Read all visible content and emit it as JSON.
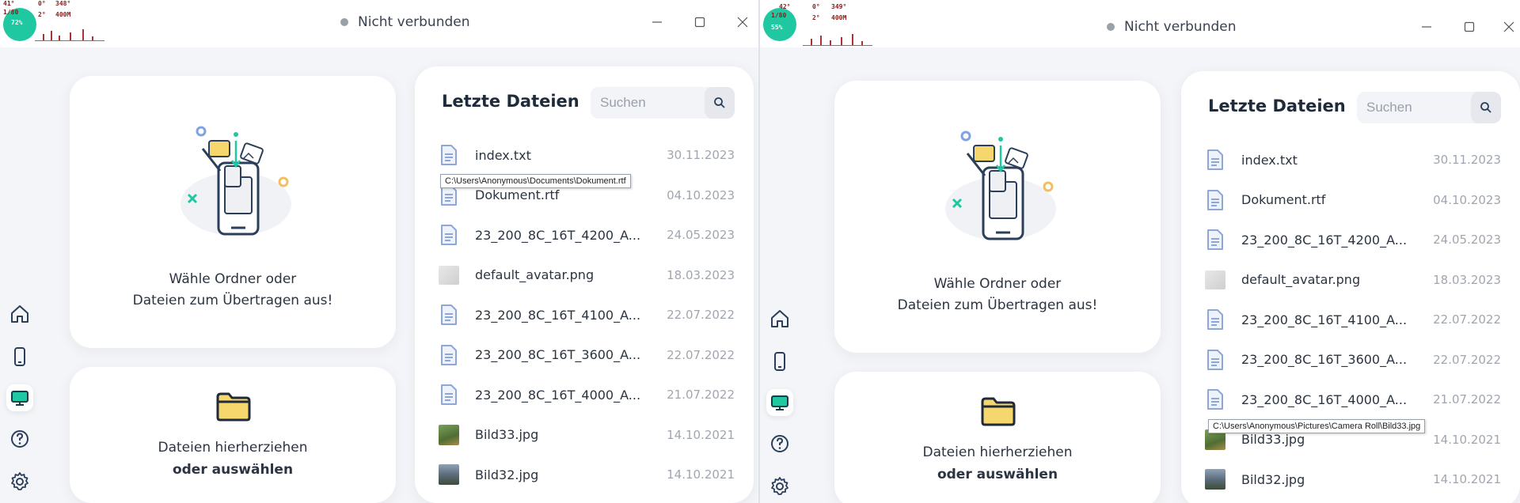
{
  "status": {
    "label": "Nicht verbunden",
    "dot_color": "#9aa0aa"
  },
  "window_controls": {
    "minimize_icon": "minimize-icon",
    "maximize_icon": "maximize-icon",
    "close_icon": "close-icon"
  },
  "overlay": {
    "left_values": [
      "41°",
      "0°",
      "348°",
      "1/80",
      "2°",
      "400M",
      "72%"
    ],
    "right_values": [
      "42°",
      "0°",
      "349°",
      "1/80",
      "2°",
      "400M",
      "55%"
    ]
  },
  "nav": {
    "items": [
      {
        "name": "home",
        "icon": "home-icon"
      },
      {
        "name": "phone",
        "icon": "phone-icon"
      },
      {
        "name": "computer",
        "icon": "monitor-icon",
        "active": true
      },
      {
        "name": "help",
        "icon": "help-icon"
      },
      {
        "name": "settings",
        "icon": "gear-icon"
      }
    ],
    "accent": "#1fc8a0"
  },
  "select_card": {
    "line1": "Wähle Ordner oder",
    "line2": "Dateien zum Übertragen aus!"
  },
  "drop_card": {
    "line1": "Dateien hierherziehen",
    "line2": "oder auswählen"
  },
  "recent": {
    "title": "Letzte Dateien",
    "search_placeholder": "Suchen",
    "files": [
      {
        "name": "index.txt",
        "date": "30.11.2023",
        "type": "doc"
      },
      {
        "name": "Dokument.rtf",
        "date": "04.10.2023",
        "type": "doc"
      },
      {
        "name": "23_200_8C_16T_4200_A...",
        "date": "24.05.2023",
        "type": "doc"
      },
      {
        "name": "default_avatar.png",
        "date": "18.03.2023",
        "type": "image-gray"
      },
      {
        "name": "23_200_8C_16T_4100_A...",
        "date": "22.07.2022",
        "type": "doc"
      },
      {
        "name": "23_200_8C_16T_3600_A...",
        "date": "22.07.2022",
        "type": "doc"
      },
      {
        "name": "23_200_8C_16T_4000_A...",
        "date": "21.07.2022",
        "type": "doc"
      },
      {
        "name": "Bild33.jpg",
        "date": "14.10.2021",
        "type": "photo1"
      },
      {
        "name": "Bild32.jpg",
        "date": "14.10.2021",
        "type": "photo2"
      }
    ]
  },
  "tooltips": {
    "left": "C:\\Users\\Anonymous\\Documents\\Dokument.rtf",
    "right": "C:\\Users\\Anonymous\\Pictures\\Camera Roll\\Bild33.jpg"
  },
  "colors": {
    "accent": "#1fc8a0",
    "folder_yellow": "#f5d76e",
    "doc_blue": "#8fa7d8",
    "title_dark": "#1f2a3a"
  }
}
